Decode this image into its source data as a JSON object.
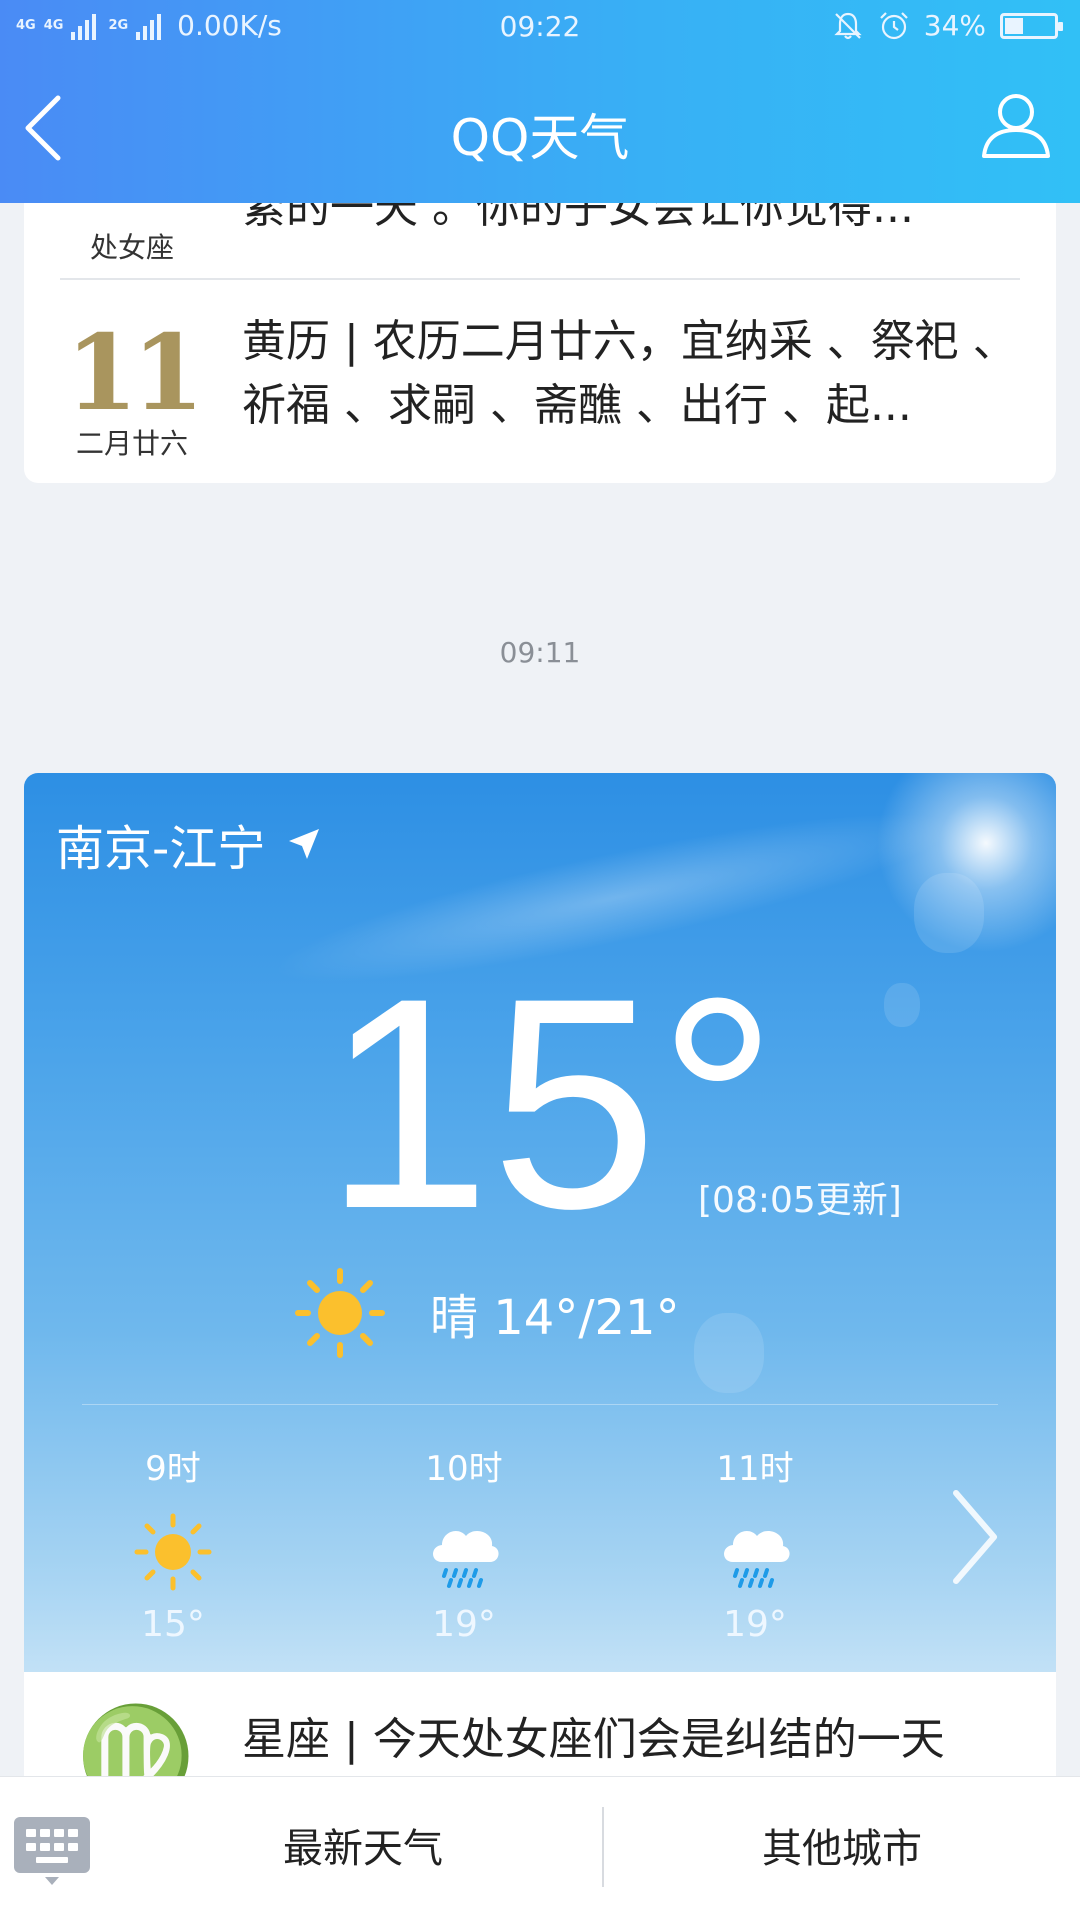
{
  "status_bar": {
    "network_1": "4G",
    "network_2": "4G",
    "network_3": "2G",
    "speed": "0.00K/s",
    "time": "09:22",
    "battery_text": "34%",
    "battery_level": 0.34
  },
  "nav": {
    "title": "QQ天气",
    "back_icon": "back-arrow-icon",
    "profile_icon": "user-icon"
  },
  "horoscope_partial": {
    "text": "紧的一天 。你的子女会让你觉得...",
    "caption": "处女座"
  },
  "almanac": {
    "day": "11",
    "lunar_date": "二月廿六",
    "text": "黄历 | 农历二月廿六，宜纳采 、祭祀 、祈福 、求嗣 、斋醮 、出行 、起..."
  },
  "message_time": "09:11",
  "weather": {
    "location": "南京-江宁",
    "location_icon": "location-arrow-icon",
    "temperature": "15°",
    "updated": "[08:05更新]",
    "condition_icon": "sun-icon",
    "summary": "晴 14°/21°",
    "hourly": [
      {
        "hour": "9时",
        "icon": "sun-icon",
        "temp": "15°"
      },
      {
        "hour": "10时",
        "icon": "rain-cloud-icon",
        "temp": "19°"
      },
      {
        "hour": "11时",
        "icon": "rain-cloud-icon",
        "temp": "19°"
      }
    ],
    "next_icon": "chevron-right-icon"
  },
  "horoscope": {
    "text": "星座 | 今天处女座们会是纠结的一天",
    "icon": "virgo-icon"
  },
  "bottom_bar": {
    "keyboard_icon": "keyboard-icon",
    "tab_1": "最新天气",
    "tab_2": "其他城市"
  },
  "colors": {
    "header_blue": "#38b0f5",
    "almanac_gold": "#a9955e",
    "sun_yellow": "#fbc02d",
    "rain_blue": "#1e9be8"
  }
}
